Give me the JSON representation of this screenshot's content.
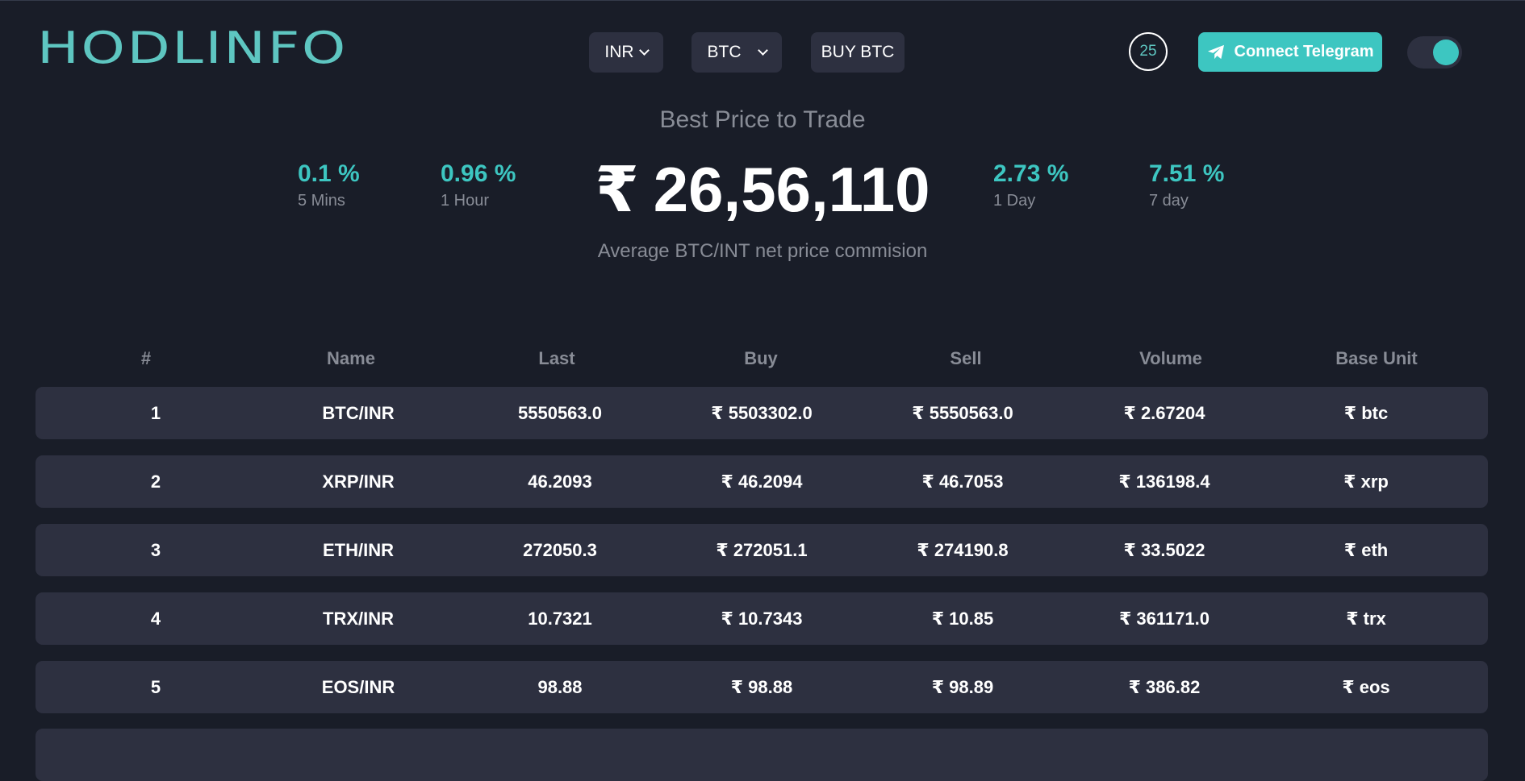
{
  "header": {
    "logo_text": "HODLINFO",
    "currency_select": "INR",
    "coin_select": "BTC",
    "buy_button": "BUY BTC",
    "timer": "25",
    "telegram_button": "Connect Telegram"
  },
  "hero": {
    "title": "Best Price to Trade",
    "price": "26,56,110",
    "currency_symbol": "₹",
    "subtitle": "Average BTC/INT net price commision",
    "stats": [
      {
        "value": "0.1 %",
        "period": "5 Mins"
      },
      {
        "value": "0.96 %",
        "period": "1 Hour"
      },
      {
        "value": "2.73 %",
        "period": "1 Day"
      },
      {
        "value": "7.51 %",
        "period": "7 day"
      }
    ]
  },
  "table": {
    "headers": [
      "#",
      "Name",
      "Last",
      "Buy",
      "Sell",
      "Volume",
      "Base Unit"
    ],
    "rows": [
      [
        "1",
        "BTC/INR",
        "5550563.0",
        "₹ 5503302.0",
        "₹ 5550563.0",
        "₹ 2.67204",
        "₹ btc"
      ],
      [
        "2",
        "XRP/INR",
        "46.2093",
        "₹ 46.2094",
        "₹ 46.7053",
        "₹ 136198.4",
        "₹ xrp"
      ],
      [
        "3",
        "ETH/INR",
        "272050.3",
        "₹ 272051.1",
        "₹ 274190.8",
        "₹ 33.5022",
        "₹ eth"
      ],
      [
        "4",
        "TRX/INR",
        "10.7321",
        "₹ 10.7343",
        "₹ 10.85",
        "₹ 361171.0",
        "₹ trx"
      ],
      [
        "5",
        "EOS/INR",
        "98.88",
        "₹ 98.88",
        "₹ 98.89",
        "₹ 386.82",
        "₹ eos"
      ]
    ]
  },
  "colors": {
    "background": "#191d28",
    "accent": "#3dc6c1",
    "row_bg": "#2d3040",
    "muted_text": "#888c96"
  }
}
